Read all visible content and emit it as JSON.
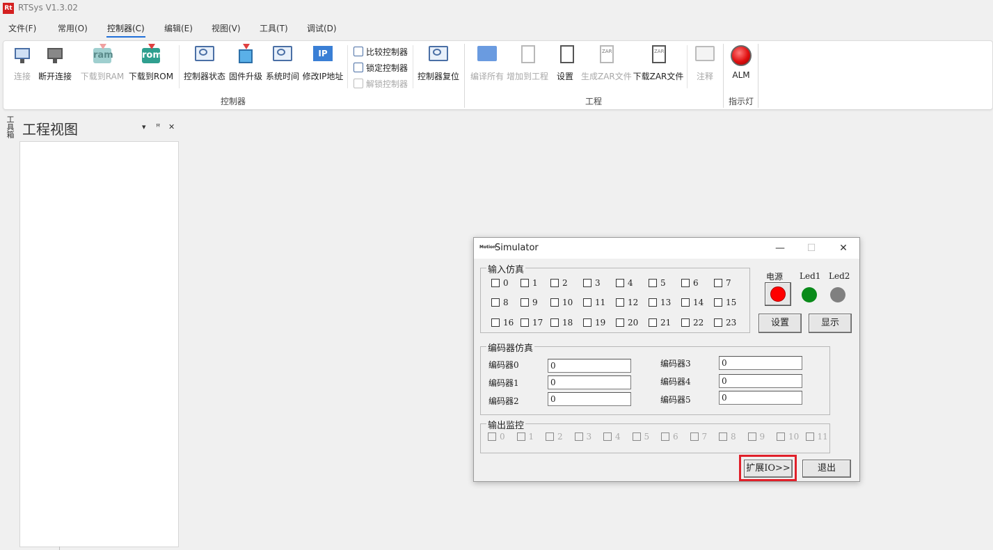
{
  "app": {
    "logo": "Rt",
    "title": "RTSys V1.3.02"
  },
  "menu": [
    "文件(F)",
    "常用(O)",
    "控制器(C)",
    "编辑(E)",
    "视图(V)",
    "工具(T)",
    "调试(D)"
  ],
  "ribbon": {
    "connect": "连接",
    "disconnect": "断开连接",
    "download_ram": "下载到RAM",
    "download_rom": "下载到ROM",
    "controller_status": "控制器状态",
    "firmware_upgrade": "固件升级",
    "system_time": "系统时间",
    "modify_ip": "修改IP地址",
    "compare_controller": "比较控制器",
    "lock_controller": "锁定控制器",
    "unlock_controller": "解锁控制器",
    "controller_reset": "控制器复位",
    "group_controller": "控制器",
    "compile_all": "编译所有",
    "add_to_project": "增加到工程",
    "settings": "设置",
    "generate_zar": "生成ZAR文件",
    "download_zar": "下载ZAR文件",
    "annotate": "注释",
    "group_project": "工程",
    "alm": "ALM",
    "group_indicator": "指示灯",
    "ram_chip_text": "ram",
    "rom_chip_text": "rom",
    "ip_chip_text": "IP",
    "zar_text": "ZAR"
  },
  "side_panel": {
    "toolbox_tab": "工具箱",
    "title": "工程视图",
    "dropdown_icon": "▾",
    "pin_icon": "ꟸ",
    "close_icon": "✕"
  },
  "simulator": {
    "icon_text": "Motion",
    "title": "Simulator",
    "minimize": "—",
    "maximize": "☐",
    "close": "✕",
    "input_group": "输入仿真",
    "inputs": [
      "0",
      "1",
      "2",
      "3",
      "4",
      "5",
      "6",
      "7",
      "8",
      "9",
      "10",
      "11",
      "12",
      "13",
      "14",
      "15",
      "16",
      "17",
      "18",
      "19",
      "20",
      "21",
      "22",
      "23"
    ],
    "power_label": "电源",
    "led1_label": "Led1",
    "led2_label": "Led2",
    "setup_button": "设置",
    "display_button": "显示",
    "encoder_group": "编码器仿真",
    "encoders": [
      {
        "label": "编码器0",
        "value": "0"
      },
      {
        "label": "编码器1",
        "value": "0"
      },
      {
        "label": "编码器2",
        "value": "0"
      },
      {
        "label": "编码器3",
        "value": "0"
      },
      {
        "label": "编码器4",
        "value": "0"
      },
      {
        "label": "编码器5",
        "value": "0"
      }
    ],
    "output_group": "输出监控",
    "outputs": [
      "0",
      "1",
      "2",
      "3",
      "4",
      "5",
      "6",
      "7",
      "8",
      "9",
      "10",
      "11"
    ],
    "expand_io_button": "扩展IO>>",
    "exit_button": "退出"
  },
  "colors": {
    "power_led": "#ff0000",
    "led1": "#0a8a1a",
    "led2": "#808080",
    "highlight": "#e0202a",
    "menu_accent": "#1e6fd9"
  }
}
